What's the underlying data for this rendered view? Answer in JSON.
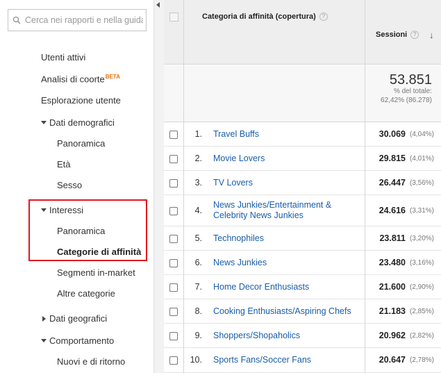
{
  "sidebar": {
    "search_placeholder": "Cerca nei rapporti e nella guida",
    "items": {
      "utenti_attivi": "Utenti attivi",
      "analisi_coorte": "Analisi di coorte",
      "beta": "BETA",
      "esplorazione_utente": "Esplorazione utente",
      "dati_demografici": "Dati demografici",
      "panoramica_demo": "Panoramica",
      "eta": "Età",
      "sesso": "Sesso",
      "interessi": "Interessi",
      "panoramica_int": "Panoramica",
      "categorie_affinita": "Categorie di affinità",
      "segmenti_in_market": "Segmenti in-market",
      "altre_categorie": "Altre categorie",
      "dati_geografici": "Dati geografici",
      "comportamento": "Comportamento",
      "nuovi_ritorno": "Nuovi e di ritorno"
    }
  },
  "table": {
    "col_category": "Categoria di affinità (copertura)",
    "col_sessions": "Sessioni",
    "help_glyph": "?",
    "sort_glyph": "↓",
    "total_value": "53.851",
    "total_label": "% del totale:",
    "total_detail": "62,42% (86.278)",
    "rows": [
      {
        "num": "1.",
        "name": "Travel Buffs",
        "value": "30.069",
        "pct": "(4,04%)"
      },
      {
        "num": "2.",
        "name": "Movie Lovers",
        "value": "29.815",
        "pct": "(4,01%)"
      },
      {
        "num": "3.",
        "name": "TV Lovers",
        "value": "26.447",
        "pct": "(3,56%)"
      },
      {
        "num": "4.",
        "name": "News Junkies/Entertainment & Celebrity News Junkies",
        "value": "24.616",
        "pct": "(3,31%)"
      },
      {
        "num": "5.",
        "name": "Technophiles",
        "value": "23.811",
        "pct": "(3,20%)"
      },
      {
        "num": "6.",
        "name": "News Junkies",
        "value": "23.480",
        "pct": "(3,16%)"
      },
      {
        "num": "7.",
        "name": "Home Decor Enthusiasts",
        "value": "21.600",
        "pct": "(2,90%)"
      },
      {
        "num": "8.",
        "name": "Cooking Enthusiasts/Aspiring Chefs",
        "value": "21.183",
        "pct": "(2,85%)"
      },
      {
        "num": "9.",
        "name": "Shoppers/Shopaholics",
        "value": "20.962",
        "pct": "(2,82%)"
      },
      {
        "num": "10.",
        "name": "Sports Fans/Soccer Fans",
        "value": "20.647",
        "pct": "(2,78%)"
      }
    ]
  },
  "colors": {
    "link": "#1a5da9",
    "highlight_border": "#e0171e",
    "beta": "#e8710a"
  }
}
